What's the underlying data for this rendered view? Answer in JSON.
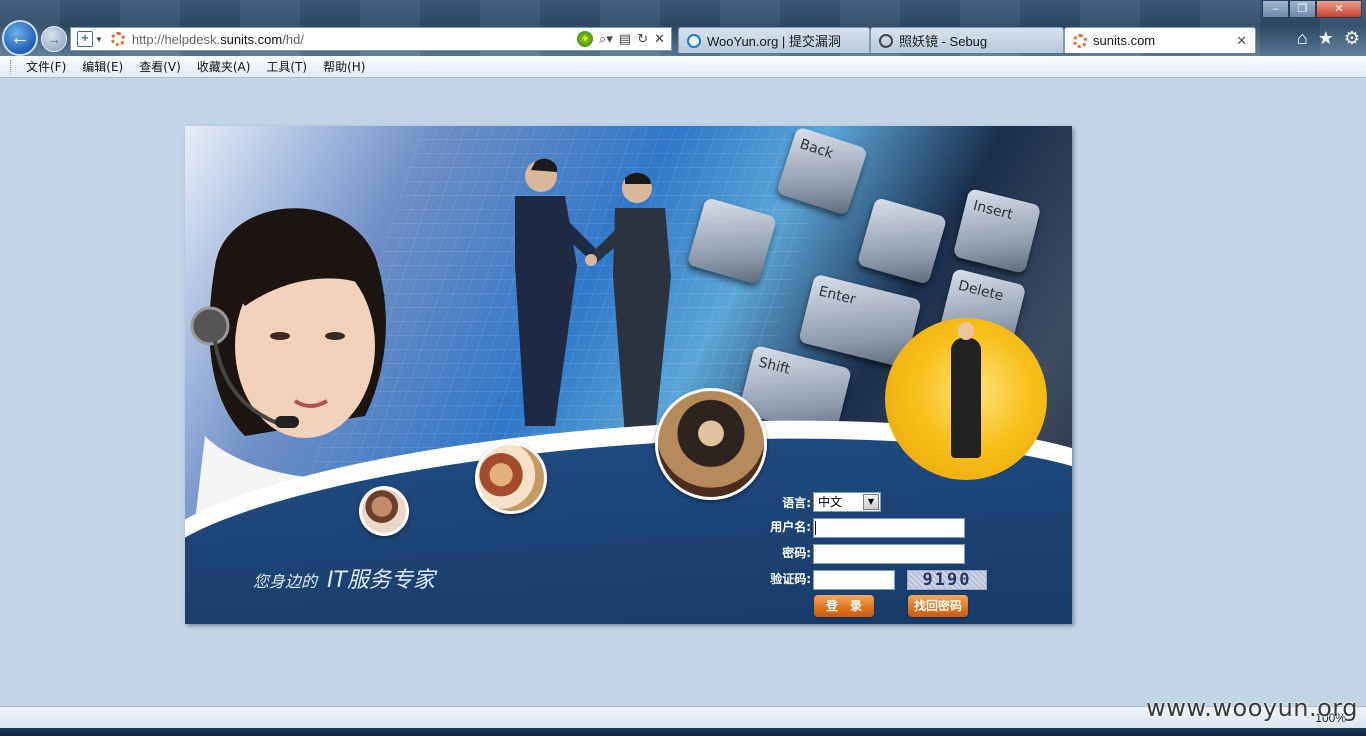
{
  "browser": {
    "address_url_prefix": "http://helpdesk.",
    "address_url_domain": "sunits.com",
    "address_url_path": "/hd/",
    "tabs": [
      {
        "label": "WooYun.org | 提交漏洞",
        "icon": "ie-icon",
        "active": false
      },
      {
        "label": "照妖镜 - Sebug",
        "icon": "sebug-icon",
        "active": false
      },
      {
        "label": "sunits.com",
        "icon": "loading-icon",
        "active": true
      }
    ],
    "menu": [
      "文件(F)",
      "编辑(E)",
      "查看(V)",
      "收藏夹(A)",
      "工具(T)",
      "帮助(H)"
    ],
    "zoom": "100%"
  },
  "banner": {
    "slogan_part1": "您身边的",
    "slogan_part2": "IT服务专家",
    "keyboard_keys": [
      "Back",
      "Enter",
      "Shift",
      "Insert",
      "Delete"
    ]
  },
  "login": {
    "language_label": "语言:",
    "language_value": "中文",
    "username_label": "用户名:",
    "password_label": "密码:",
    "captcha_label": "验证码:",
    "captcha_text": "9190",
    "login_button": "登　录",
    "recover_button": "找回密码"
  },
  "watermark": "www.wooyun.org",
  "colors": {
    "page_background": "#c3d4e6",
    "banner_blue": "#1f4a80",
    "button_orange": "#e0711c"
  }
}
